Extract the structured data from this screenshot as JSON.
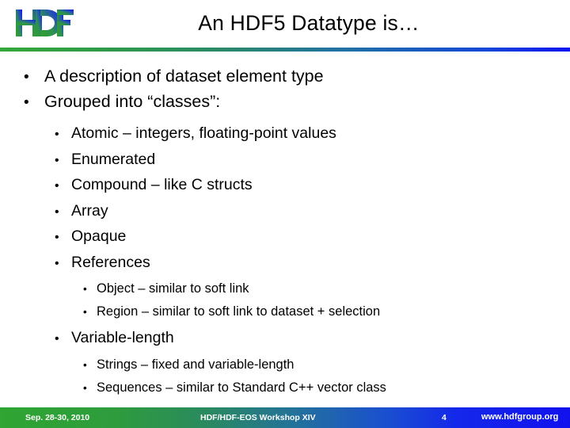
{
  "header": {
    "logo_alt": "HDF logo",
    "title": "An HDF5 Datatype is…",
    "rule_color_left": "#34a83a",
    "rule_color_right": "#0a14f0"
  },
  "body": {
    "bullets": [
      {
        "level": 1,
        "marker": "•",
        "text": "A description of dataset element type"
      },
      {
        "level": 1,
        "marker": "•",
        "text": "Grouped into “classes”:"
      },
      {
        "level": 2,
        "marker": "•",
        "text": "Atomic – integers, floating-point values"
      },
      {
        "level": 2,
        "marker": "•",
        "text": "Enumerated"
      },
      {
        "level": 2,
        "marker": "•",
        "text": "Compound – like C structs"
      },
      {
        "level": 2,
        "marker": "•",
        "text": "Array"
      },
      {
        "level": 2,
        "marker": "•",
        "text": "Opaque"
      },
      {
        "level": 2,
        "marker": "•",
        "text": "References"
      },
      {
        "level": 3,
        "marker": "•",
        "text": "Object – similar to soft link"
      },
      {
        "level": 3,
        "marker": "•",
        "text": "Region – similar to soft link to dataset + selection"
      },
      {
        "level": 2,
        "marker": "•",
        "text": "Variable-length"
      },
      {
        "level": 3,
        "marker": "•",
        "text": "Strings – fixed and variable-length"
      },
      {
        "level": 3,
        "marker": "•",
        "text": "Sequences – similar to Standard C++ vector class"
      }
    ]
  },
  "footer": {
    "date": "Sep. 28-30, 2010",
    "event": "HDF/HDF-EOS Workshop XIV",
    "page_number": "4",
    "url": "www.hdfgroup.org",
    "background_left": "#2fa532",
    "background_right": "#1111ee",
    "text_color": "#ffffff"
  }
}
